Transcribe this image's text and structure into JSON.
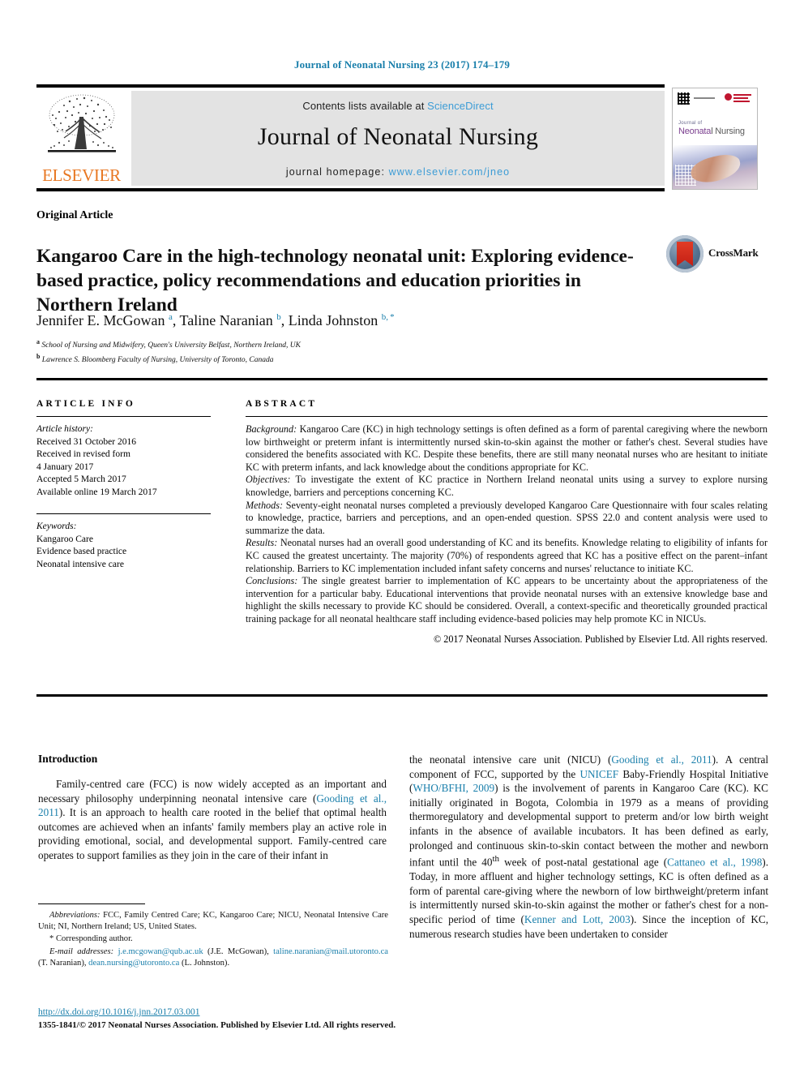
{
  "running_head": "Journal of Neonatal Nursing 23 (2017) 174–179",
  "masthead": {
    "contents_prefix": "Contents lists available at",
    "sciencedirect": "ScienceDirect",
    "journal_title": "Journal of Neonatal Nursing",
    "homepage_prefix": "journal homepage:",
    "homepage_url": "www.elsevier.com/jneo",
    "publisher_logo_word": "ELSEVIER",
    "cover": {
      "small_title": "Journal of",
      "big_title_part1": "Neonata",
      "big_title_part2": "l Nursing"
    }
  },
  "article": {
    "type": "Original Article",
    "title": "Kangaroo Care in the high-technology neonatal unit: Exploring evidence-based practice, policy recommendations and education priorities in Northern Ireland",
    "crossmark_label": "CrossMark",
    "authors_html": "Jennifer E. McGowan <sup>a</sup>, Taline Naranian <sup>b</sup>, Linda Johnston <sup>b, *</sup>",
    "affiliations": [
      {
        "marker": "a",
        "text": "School of Nursing and Midwifery, Queen's University Belfast, Northern Ireland, UK"
      },
      {
        "marker": "b",
        "text": "Lawrence S. Bloomberg Faculty of Nursing, University of Toronto, Canada"
      }
    ]
  },
  "article_info": {
    "heading": "ARTICLE INFO",
    "history_label": "Article history:",
    "history": [
      "Received 31 October 2016",
      "Received in revised form",
      "4 January 2017",
      "Accepted 5 March 2017",
      "Available online 19 March 2017"
    ],
    "keywords_label": "Keywords:",
    "keywords": [
      "Kangaroo Care",
      "Evidence based practice",
      "Neonatal intensive care"
    ]
  },
  "abstract": {
    "heading": "ABSTRACT",
    "sections": [
      {
        "label": "Background:",
        "text": " Kangaroo Care (KC) in high technology settings is often defined as a form of parental caregiving where the newborn low birthweight or preterm infant is intermittently nursed skin-to-skin against the mother or father's chest. Several studies have considered the benefits associated with KC. Despite these benefits, there are still many neonatal nurses who are hesitant to initiate KC with preterm infants, and lack knowledge about the conditions appropriate for KC."
      },
      {
        "label": "Objectives:",
        "text": " To investigate the extent of KC practice in Northern Ireland neonatal units using a survey to explore nursing knowledge, barriers and perceptions concerning KC."
      },
      {
        "label": "Methods:",
        "text": " Seventy-eight neonatal nurses completed a previously developed Kangaroo Care Questionnaire with four scales relating to knowledge, practice, barriers and perceptions, and an open-ended question. SPSS 22.0 and content analysis were used to summarize the data."
      },
      {
        "label": "Results:",
        "text": " Neonatal nurses had an overall good understanding of KC and its benefits. Knowledge relating to eligibility of infants for KC caused the greatest uncertainty. The majority (70%) of respondents agreed that KC has a positive effect on the parent–infant relationship. Barriers to KC implementation included infant safety concerns and nurses' reluctance to initiate KC."
      },
      {
        "label": "Conclusions:",
        "text": " The single greatest barrier to implementation of KC appears to be uncertainty about the appropriateness of the intervention for a particular baby. Educational interventions that provide neonatal nurses with an extensive knowledge base and highlight the skills necessary to provide KC should be considered. Overall, a context-specific and theoretically grounded practical training package for all neonatal healthcare staff including evidence-based policies may help promote KC in NICUs."
      }
    ],
    "copyright": "© 2017 Neonatal Nurses Association. Published by Elsevier Ltd. All rights reserved."
  },
  "body": {
    "intro_heading": "Introduction",
    "left_paragraph_parts": [
      {
        "type": "text",
        "value": "Family-centred care (FCC) is now widely accepted as an important and necessary philosophy underpinning neonatal intensive care ("
      },
      {
        "type": "link",
        "value": "Gooding et al., 2011"
      },
      {
        "type": "text",
        "value": "). It is an approach to health care rooted in the belief that optimal health outcomes are achieved when an infants' family members play an active role in providing emotional, social, and developmental support. Family-centred care operates to support families as they join in the care of their infant in"
      }
    ],
    "right_paragraph_parts": [
      {
        "type": "text",
        "value": "the neonatal intensive care unit (NICU) ("
      },
      {
        "type": "link",
        "value": "Gooding et al., 2011"
      },
      {
        "type": "text",
        "value": "). A central component of FCC, supported by the "
      },
      {
        "type": "link",
        "value": "UNICEF"
      },
      {
        "type": "text",
        "value": " Baby-Friendly Hospital Initiative ("
      },
      {
        "type": "link",
        "value": "WHO/BFHI, 2009"
      },
      {
        "type": "text",
        "value": ") is the involvement of parents in Kangaroo Care (KC). KC initially originated in Bogota, Colombia in 1979 as a means of providing thermoregulatory and developmental support to preterm and/or low birth weight infants in the absence of available incubators. It has been defined as early, prolonged and continuous skin-to-skin contact between the mother and newborn infant until the 40"
      },
      {
        "type": "sup",
        "value": "th"
      },
      {
        "type": "text",
        "value": " week of post-natal gestational age ("
      },
      {
        "type": "link",
        "value": "Cattaneo et al., 1998"
      },
      {
        "type": "text",
        "value": "). Today, in more affluent and higher technology settings, KC is often defined as a form of parental care-giving where the newborn of low birthweight/preterm infant is intermittently nursed skin-to-skin against the mother or father's chest for a non-specific period of time ("
      },
      {
        "type": "link",
        "value": "Kenner and Lott, 2003"
      },
      {
        "type": "text",
        "value": "). Since the inception of KC, numerous research studies have been undertaken to consider"
      }
    ]
  },
  "footnotes": {
    "abbreviations_label": "Abbreviations:",
    "abbreviations_text": " FCC, Family Centred Care; KC, Kangaroo Care; NICU, Neonatal Intensive Care Unit; NI, Northern Ireland; US, United States.",
    "corresponding_marker": "*",
    "corresponding_text": "Corresponding author.",
    "email_label": "E-mail addresses:",
    "emails": [
      {
        "address": "j.e.mcgowan@qub.ac.uk",
        "owner": "(J.E. McGowan)"
      },
      {
        "address": "taline.naranian@mail.utoronto.ca",
        "owner": "(T. Naranian)"
      },
      {
        "address": "dean.nursing@utoronto.ca",
        "owner": "(L. Johnston)"
      }
    ],
    "doi_url": "http://dx.doi.org/10.1016/j.jnn.2017.03.001",
    "issn_line": "1355-1841/© 2017 Neonatal Nurses Association. Published by Elsevier Ltd. All rights reserved."
  },
  "colors": {
    "link": "#1a7fab",
    "sciencedirect": "#3c9cd6",
    "elsevier_orange": "#e87722",
    "band": "#e3e3e3"
  }
}
